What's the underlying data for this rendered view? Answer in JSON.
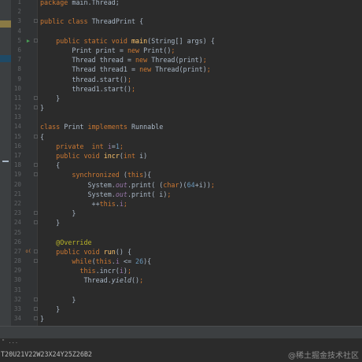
{
  "editor": {
    "lines": [
      {
        "n": "1",
        "tokens": [
          {
            "t": "package ",
            "c": "kw"
          },
          {
            "t": "main.Thread;",
            "c": "plain"
          }
        ]
      },
      {
        "n": "2",
        "tokens": []
      },
      {
        "n": "3",
        "fold": true,
        "tokens": [
          {
            "t": "public class ",
            "c": "kw"
          },
          {
            "t": "ThreadPrint {",
            "c": "plain"
          }
        ]
      },
      {
        "n": "4",
        "tokens": []
      },
      {
        "n": "5",
        "run": true,
        "fold": true,
        "tokens": [
          {
            "t": "    public static void ",
            "c": "kw"
          },
          {
            "t": "main",
            "c": "fn"
          },
          {
            "t": "(String[] args) {",
            "c": "plain"
          }
        ]
      },
      {
        "n": "6",
        "tokens": [
          {
            "t": "        Print print = ",
            "c": "plain"
          },
          {
            "t": "new ",
            "c": "kw"
          },
          {
            "t": "Print()",
            "c": "plain"
          },
          {
            "t": ";",
            "c": "kw"
          }
        ]
      },
      {
        "n": "7",
        "tokens": [
          {
            "t": "        Thread thread = ",
            "c": "plain"
          },
          {
            "t": "new ",
            "c": "kw"
          },
          {
            "t": "Thread(print)",
            "c": "plain"
          },
          {
            "t": ";",
            "c": "kw"
          }
        ]
      },
      {
        "n": "8",
        "tokens": [
          {
            "t": "        Thread thread1 = ",
            "c": "plain"
          },
          {
            "t": "new ",
            "c": "kw"
          },
          {
            "t": "Thread(print)",
            "c": "plain"
          },
          {
            "t": ";",
            "c": "kw"
          }
        ]
      },
      {
        "n": "9",
        "tokens": [
          {
            "t": "        thread.start()",
            "c": "plain"
          },
          {
            "t": ";",
            "c": "kw"
          }
        ]
      },
      {
        "n": "10",
        "tokens": [
          {
            "t": "        thread1.start()",
            "c": "plain"
          },
          {
            "t": ";",
            "c": "kw"
          }
        ]
      },
      {
        "n": "11",
        "fold": true,
        "tokens": [
          {
            "t": "    }",
            "c": "plain"
          }
        ]
      },
      {
        "n": "12",
        "fold": true,
        "tokens": [
          {
            "t": "}",
            "c": "plain"
          }
        ]
      },
      {
        "n": "13",
        "tokens": []
      },
      {
        "n": "14",
        "tokens": [
          {
            "t": "class ",
            "c": "kw"
          },
          {
            "t": "Print ",
            "c": "plain"
          },
          {
            "t": "implements ",
            "c": "kw"
          },
          {
            "t": "Runnable",
            "c": "plain"
          }
        ]
      },
      {
        "n": "15",
        "fold": true,
        "tokens": [
          {
            "t": "{",
            "c": "plain"
          }
        ]
      },
      {
        "n": "16",
        "tokens": [
          {
            "t": "    private  int ",
            "c": "kw"
          },
          {
            "t": "i",
            "c": "field"
          },
          {
            "t": "=",
            "c": "plain"
          },
          {
            "t": "1",
            "c": "num"
          },
          {
            "t": ";",
            "c": "kw"
          }
        ]
      },
      {
        "n": "17",
        "tokens": [
          {
            "t": "    public void ",
            "c": "kw"
          },
          {
            "t": "incr",
            "c": "fn"
          },
          {
            "t": "(",
            "c": "plain"
          },
          {
            "t": "int ",
            "c": "kw"
          },
          {
            "t": "i)",
            "c": "plain"
          }
        ]
      },
      {
        "n": "18",
        "fold": true,
        "tokens": [
          {
            "t": "    {",
            "c": "plain"
          }
        ]
      },
      {
        "n": "19",
        "fold": true,
        "tokens": [
          {
            "t": "        synchronized ",
            "c": "kw"
          },
          {
            "t": "(",
            "c": "plain"
          },
          {
            "t": "this",
            "c": "kw"
          },
          {
            "t": "){",
            "c": "plain"
          }
        ]
      },
      {
        "n": "20",
        "tokens": [
          {
            "t": "            System.",
            "c": "plain"
          },
          {
            "t": "out",
            "c": "static"
          },
          {
            "t": ".print( (",
            "c": "plain"
          },
          {
            "t": "char",
            "c": "kw"
          },
          {
            "t": ")(",
            "c": "plain"
          },
          {
            "t": "64",
            "c": "num"
          },
          {
            "t": "+i))",
            "c": "plain"
          },
          {
            "t": ";",
            "c": "kw"
          }
        ]
      },
      {
        "n": "21",
        "tokens": [
          {
            "t": "            System.",
            "c": "plain"
          },
          {
            "t": "out",
            "c": "static"
          },
          {
            "t": ".print( i)",
            "c": "plain"
          },
          {
            "t": ";",
            "c": "kw"
          }
        ]
      },
      {
        "n": "22",
        "tokens": [
          {
            "t": "             ++",
            "c": "plain"
          },
          {
            "t": "this",
            "c": "kw"
          },
          {
            "t": ".",
            "c": "plain"
          },
          {
            "t": "i",
            "c": "field"
          },
          {
            "t": ";",
            "c": "kw"
          }
        ]
      },
      {
        "n": "23",
        "fold": true,
        "tokens": [
          {
            "t": "        }",
            "c": "plain"
          }
        ]
      },
      {
        "n": "24",
        "fold": true,
        "tokens": [
          {
            "t": "    }",
            "c": "plain"
          }
        ]
      },
      {
        "n": "25",
        "tokens": []
      },
      {
        "n": "26",
        "tokens": [
          {
            "t": "    @Override",
            "c": "annot"
          }
        ]
      },
      {
        "n": "27",
        "override": true,
        "fold": true,
        "tokens": [
          {
            "t": "    public void ",
            "c": "kw"
          },
          {
            "t": "run",
            "c": "fn"
          },
          {
            "t": "() {",
            "c": "plain"
          }
        ]
      },
      {
        "n": "28",
        "fold": true,
        "tokens": [
          {
            "t": "        while",
            "c": "kw"
          },
          {
            "t": "(",
            "c": "plain"
          },
          {
            "t": "this",
            "c": "kw"
          },
          {
            "t": ".",
            "c": "plain"
          },
          {
            "t": "i",
            "c": "field"
          },
          {
            "t": " <= ",
            "c": "plain"
          },
          {
            "t": "26",
            "c": "num"
          },
          {
            "t": "){",
            "c": "plain"
          }
        ]
      },
      {
        "n": "29",
        "tokens": [
          {
            "t": "          this",
            "c": "kw"
          },
          {
            "t": ".incr(",
            "c": "plain"
          },
          {
            "t": "i",
            "c": "field"
          },
          {
            "t": ")",
            "c": "plain"
          },
          {
            "t": ";",
            "c": "kw"
          }
        ]
      },
      {
        "n": "30",
        "tokens": [
          {
            "t": "           Thread.",
            "c": "plain"
          },
          {
            "t": "yield",
            "c": "italic"
          },
          {
            "t": "()",
            "c": "plain"
          },
          {
            "t": ";",
            "c": "kw"
          }
        ]
      },
      {
        "n": "31",
        "tokens": []
      },
      {
        "n": "32",
        "fold": true,
        "tokens": [
          {
            "t": "        }",
            "c": "plain"
          }
        ]
      },
      {
        "n": "33",
        "fold": true,
        "tokens": [
          {
            "t": "    }",
            "c": "plain"
          }
        ]
      },
      {
        "n": "34",
        "fold": true,
        "tokens": [
          {
            "t": "}",
            "c": "plain"
          }
        ]
      }
    ]
  },
  "gutter_icons": {
    "run": "▶",
    "override": "o("
  },
  "console": {
    "prompt": "\" ...",
    "output": "T20U21V22W23X24Y25Z26B2"
  },
  "watermark": "@稀土掘金技术社区",
  "colors": {
    "background": "#2b2b2b",
    "keyword": "#cc7832",
    "number": "#6897bb",
    "method": "#ffc66d",
    "field": "#9876aa",
    "annotation": "#bbb529",
    "text": "#a9b7c6"
  }
}
